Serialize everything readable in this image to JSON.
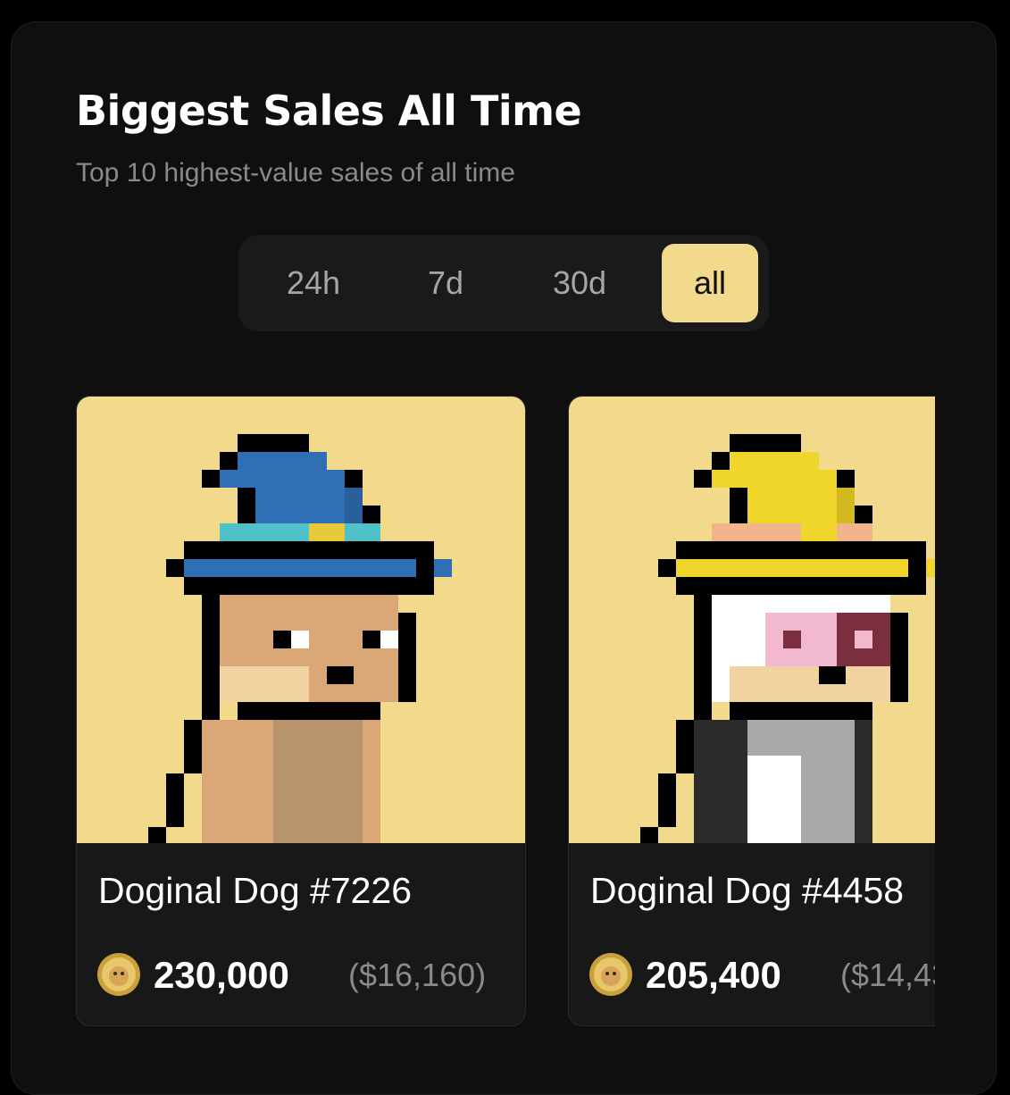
{
  "header": {
    "title": "Biggest Sales All Time",
    "subtitle": "Top 10 highest-value sales of all time"
  },
  "tabs": [
    {
      "label": "24h",
      "active": false
    },
    {
      "label": "7d",
      "active": false
    },
    {
      "label": "30d",
      "active": false
    },
    {
      "label": "all",
      "active": true
    }
  ],
  "cards": [
    {
      "name": "Doginal Dog #7226",
      "price": "230,000",
      "usd": "($16,160)",
      "hat_color": "blue"
    },
    {
      "name": "Doginal Dog #4458",
      "price": "205,400",
      "usd": "($14,43",
      "hat_color": "yellow"
    }
  ],
  "colors": {
    "accent": "#f2d98c",
    "background": "#0f0f0f",
    "card": "#181818",
    "muted_text": "#8a8a8a"
  },
  "icons": {
    "coin": "doge-coin-icon"
  }
}
